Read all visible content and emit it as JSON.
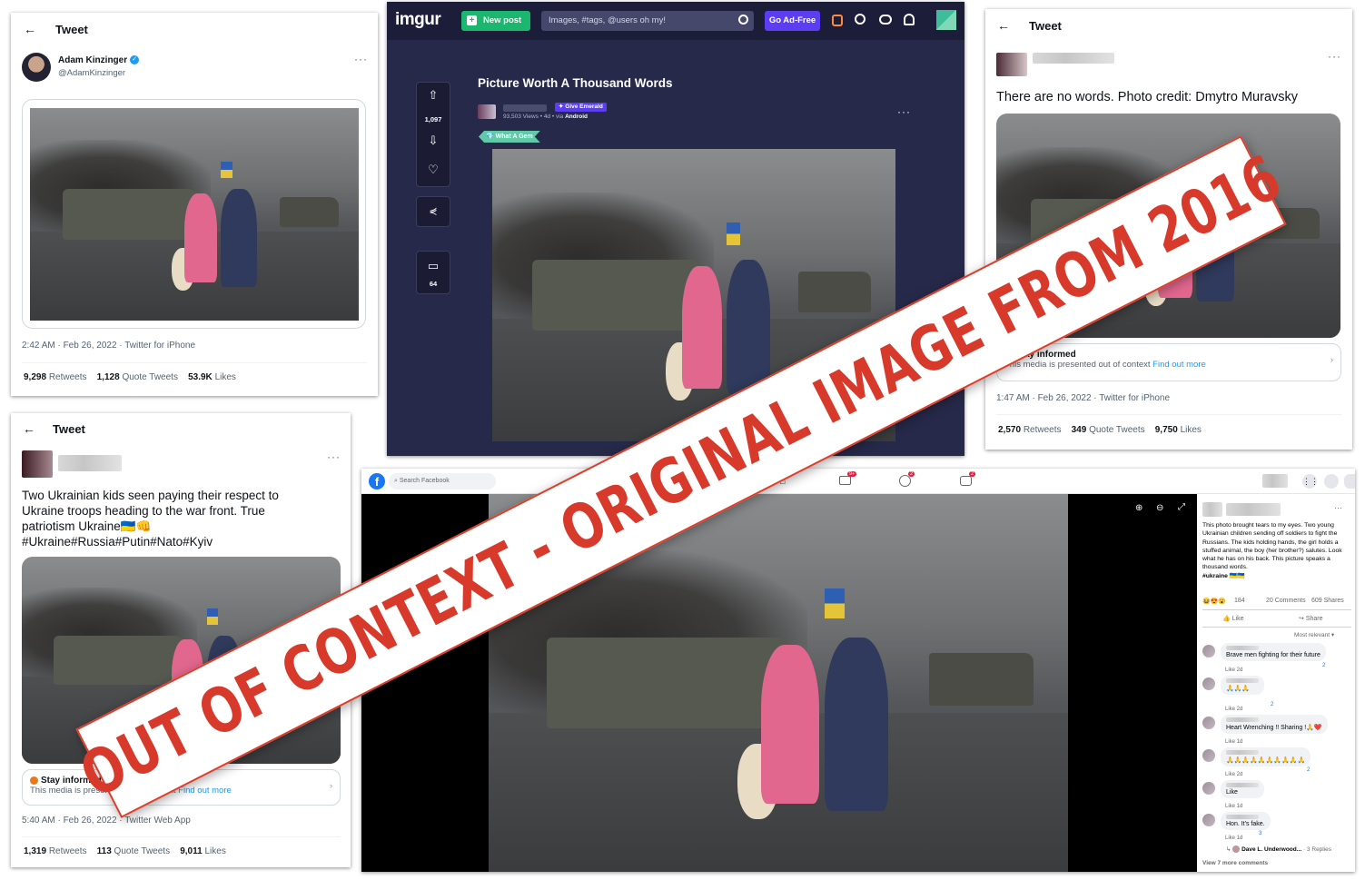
{
  "tweet1": {
    "header": "Tweet",
    "back_icon": "←",
    "name": "Adam Kinzinger",
    "handle": "@AdamKinzinger",
    "more": "···",
    "meta": "2:42 AM · Feb 26, 2022 · Twitter for iPhone",
    "retweets": "9,298",
    "retweets_label": "Retweets",
    "quotes": "1,128",
    "quotes_label": "Quote Tweets",
    "likes": "53.9K",
    "likes_label": "Likes",
    "verified_color": "#1d9bf0"
  },
  "imgur": {
    "logo": "imgur",
    "new_post": "New post",
    "search_placeholder": "Images, #tags, @users oh my!",
    "go_adfree": "Go Ad-Free",
    "title": "Picture Worth A Thousand Words",
    "give_emerald": "Give Emerald",
    "views": "93,503 Views",
    "age": "4d",
    "via": "via",
    "platform": "Android",
    "badge": "What A Gem",
    "votes": "1,097",
    "comments": "64",
    "more": "···",
    "accent_green": "#1bb76e",
    "accent_purple": "#5c3ef2"
  },
  "tweet3": {
    "header": "Tweet",
    "back_icon": "←",
    "more": "···",
    "text": "There are no words. Photo credit: Dmytro Muravsky",
    "notice_title": "Stay informed",
    "notice_text": "This media is presented out of context",
    "notice_link": "Find out more",
    "meta": "1:47 AM · Feb 26, 2022 · Twitter for iPhone",
    "retweets": "2,570",
    "retweets_label": "Retweets",
    "quotes": "349",
    "quotes_label": "Quote Tweets",
    "likes": "9,750",
    "likes_label": "Likes"
  },
  "tweet4": {
    "header": "Tweet",
    "back_icon": "←",
    "more": "···",
    "text_line1": "Two Ukrainian kids seen paying their respect to",
    "text_line2": "Ukraine troops heading to the war front. True",
    "text_line3": "patriotism Ukraine🇺🇦👊",
    "text_line4": "#Ukraine#Russia#Putin#Nato#Kyiv",
    "notice_title": "Stay informed",
    "notice_text": "This media is presented out of context",
    "notice_link": "Find out more",
    "meta": "5:40 AM · Feb 26, 2022 · Twitter Web App",
    "retweets": "1,319",
    "retweets_label": "Retweets",
    "quotes": "113",
    "quotes_label": "Quote Tweets",
    "likes": "9,011",
    "likes_label": "Likes"
  },
  "facebook": {
    "search_placeholder": "Search Facebook",
    "badge_watch": "9+",
    "badge_groups": "2",
    "badge_gaming": "2",
    "post_text": "This photo brought tears to my eyes. Two young Ukrainian children sending off soldiers to fight the Russians. The kids holding hands, the girl holds a stuffed animal, the boy (her brother?) salutes. Look what he has on his back. This picture speaks a thousand words.",
    "post_hashtag": "#ukraine 🇺🇦🇺🇦",
    "reactions": "184",
    "comments_count": "20 Comments",
    "shares_count": "609 Shares",
    "like_button": "Like",
    "share_button": "Share",
    "sort": "Most relevant",
    "comments": [
      {
        "text": "Brave men fighting for their future",
        "meta": "Like  2d",
        "reacts": "2"
      },
      {
        "text": "🙏🙏🙏",
        "meta": "Like  2d",
        "reacts": "2"
      },
      {
        "text": "Heart Wrenching !! Sharing !🙏❤️",
        "meta": "Like  1d",
        "reacts": ""
      },
      {
        "text": "🙏🙏🙏🙏🙏🙏🙏🙏🙏🙏",
        "meta": "Like  2d",
        "reacts": "2"
      },
      {
        "text": "Like",
        "meta": "Like  1d",
        "reacts": ""
      },
      {
        "text": "Hon. It's fake.",
        "meta": "Like  1d",
        "reacts": "3"
      }
    ],
    "reply_author": "Dave L. Underwood...",
    "reply_count": "3 Replies",
    "view_more": "View 7 more comments"
  },
  "banner": {
    "text": "OUT OF CONTEXT - ORIGINAL IMAGE FROM 2016",
    "color": "#d7392a"
  }
}
